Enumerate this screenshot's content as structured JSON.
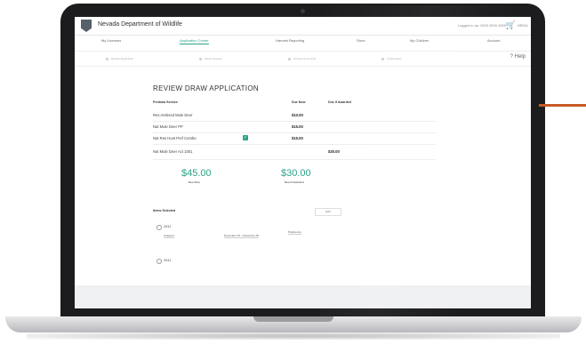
{
  "app": {
    "title": "Nevada Department of Wildlife",
    "account_text": "Logged in as: 0000 0000 0000",
    "cart_icon": "cart-icon",
    "menu_label": "MENU"
  },
  "nav": {
    "items": [
      "My Licenses",
      "Application Center",
      "Harvest Reporting",
      "Store",
      "My Children",
      "Account"
    ],
    "active_index": 1
  },
  "steps": {
    "items": [
      "Review Application",
      "Select Species",
      "Choose Hunt Units",
      "Confirmation"
    ],
    "help_label": "? Help"
  },
  "review": {
    "title": "REVIEW DRAW APPLICATION",
    "headers": {
      "service": "Predraw Service",
      "due_now": "Due Now",
      "due_if_awarded": "Due If Awarded"
    },
    "rows": [
      {
        "label": "Res Antlered Mule Deer",
        "due_now": "$10.00",
        "due_if_awarded": ""
      },
      {
        "label": "Nat Mule Deer PP",
        "due_now": "$15.00",
        "due_if_awarded": ""
      },
      {
        "label": "Nat Res Hunt Pref Combo",
        "due_now": "$15.00",
        "due_if_awarded": ""
      },
      {
        "label": "Nat Mule Deer Act 1001",
        "due_now": "",
        "due_if_awarded": "$30.00"
      }
    ],
    "totals": {
      "due_now": "$45.00",
      "due_now_label": "Due Now",
      "due_if_awarded": "$30.00",
      "due_if_awarded_label": "Due If Awarded"
    },
    "items_section": {
      "label": "Items Selected",
      "edit_label": "Edit",
      "entries": [
        {
          "code": "2811",
          "field1": "Category",
          "field2": "November 15 - November 28",
          "field3": "Preference"
        },
        {
          "code": "2811"
        }
      ]
    }
  }
}
